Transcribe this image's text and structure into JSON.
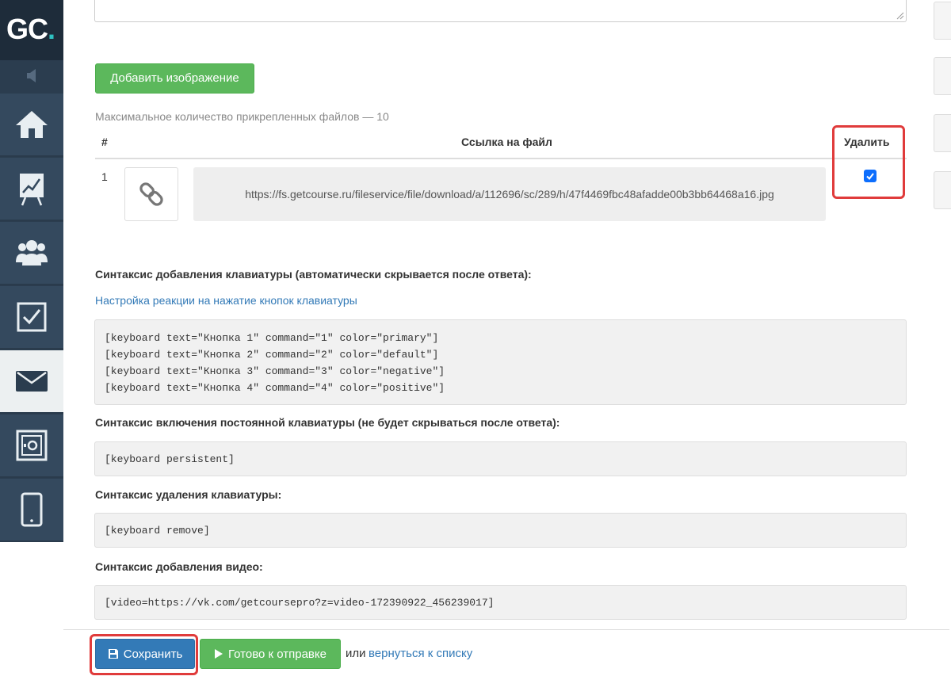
{
  "logo": {
    "text_main": "GC",
    "text_dot": "."
  },
  "sidebar": {
    "items": [
      {
        "icon": "home-icon"
      },
      {
        "icon": "chart-board-icon"
      },
      {
        "icon": "users-icon"
      },
      {
        "icon": "task-check-icon"
      },
      {
        "icon": "mail-icon",
        "active": true
      },
      {
        "icon": "safe-icon"
      },
      {
        "icon": "mobile-icon"
      }
    ]
  },
  "attachments": {
    "add_image_label": "Добавить изображение",
    "max_files_text": "Максимальное количество прикрепленных файлов — 10",
    "table": {
      "col_number": "#",
      "col_link": "Ссылка на файл",
      "col_delete": "Удалить",
      "rows": [
        {
          "number": "1",
          "icon": "link-icon",
          "url": "https://fs.getcourse.ru/fileservice/file/download/a/112696/sc/289/h/47f4469fbc48afadde00b3bb64468a16.jpg",
          "delete_checked": true
        }
      ]
    }
  },
  "keyboard": {
    "add_heading": "Синтаксис добавления клавиатуры (автоматически скрывается после ответа):",
    "settings_link": "Настройка реакции на нажатие кнопок клавиатуры",
    "add_lines": [
      "[keyboard text=\"Кнопка 1\" command=\"1\" color=\"primary\"]",
      "[keyboard text=\"Кнопка 2\" command=\"2\" color=\"default\"]",
      "[keyboard text=\"Кнопка 3\" command=\"3\" color=\"negative\"]",
      "[keyboard text=\"Кнопка 4\" command=\"4\" color=\"positive\"]"
    ],
    "persistent_heading": "Синтаксис включения постоянной клавиатуры (не будет скрываться после ответа):",
    "persistent_code": "[keyboard persistent]",
    "remove_heading": "Синтаксис удаления клавиатуры:",
    "remove_code": "[keyboard remove]",
    "video_heading": "Синтаксис добавления видео:",
    "video_code": "[video=https://vk.com/getcoursepro?z=video-172390922_456239017]"
  },
  "footer": {
    "save_label": "Сохранить",
    "ready_label": "Готово к отправке",
    "or_text": "или",
    "back_link": "вернуться к списку"
  },
  "colors": {
    "sidebar": "#34495e",
    "green": "#5cb85c",
    "blue": "#337ab7",
    "highlight": "#e03b3b"
  }
}
